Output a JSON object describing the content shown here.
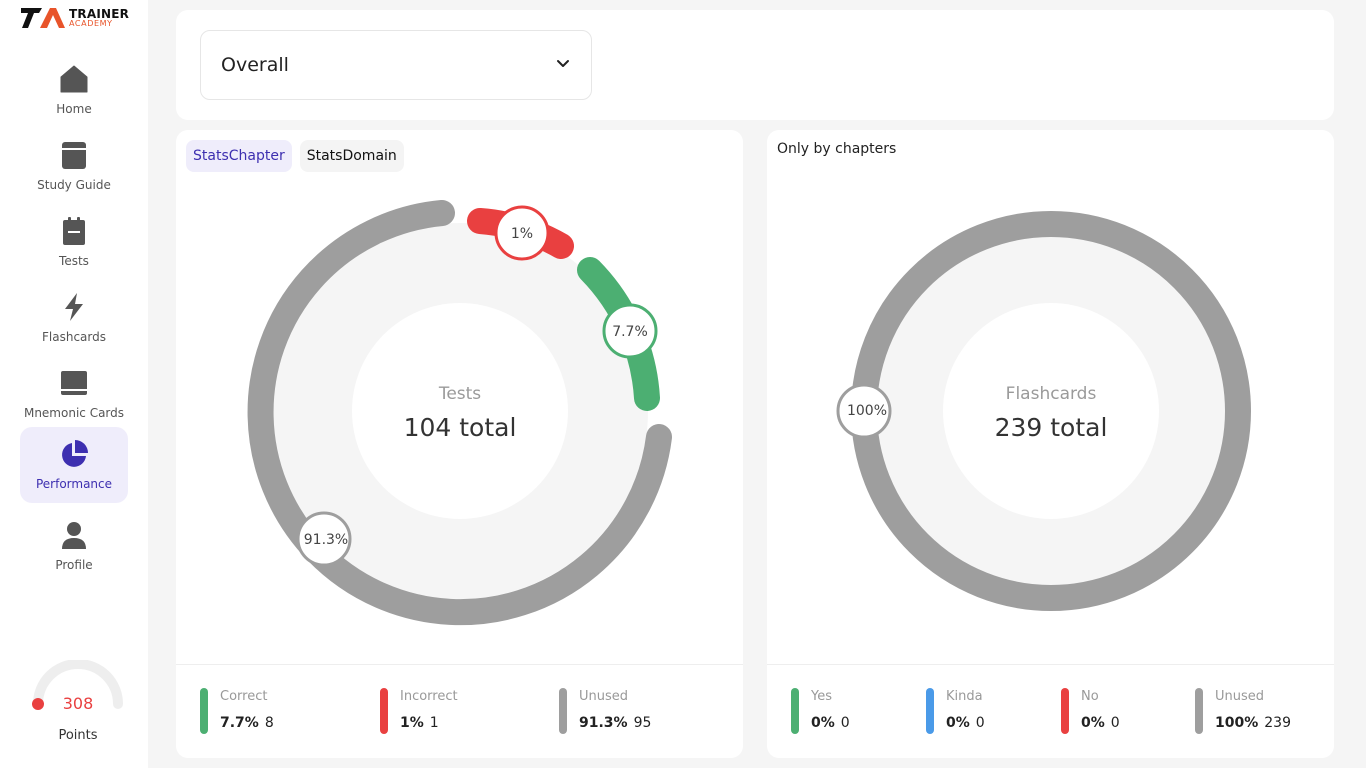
{
  "brand": {
    "line1": "TRAINER",
    "line2": "ACADEMY",
    "mark": "TA"
  },
  "sidebar": {
    "items": [
      {
        "label": "Home",
        "icon": "home-icon"
      },
      {
        "label": "Study Guide",
        "icon": "book-icon"
      },
      {
        "label": "Tests",
        "icon": "clipboard-icon"
      },
      {
        "label": "Flashcards",
        "icon": "lightning-icon"
      },
      {
        "label": "Mnemonic Cards",
        "icon": "card-icon"
      },
      {
        "label": "Performance",
        "icon": "pie-chart-icon",
        "active": true
      },
      {
        "label": "Profile",
        "icon": "user-icon"
      }
    ],
    "points": {
      "value": "308",
      "label": "Points"
    }
  },
  "filter": {
    "selected": "Overall"
  },
  "left_panel": {
    "tabs": [
      {
        "label": "StatsChapter",
        "active": true
      },
      {
        "label": "StatsDomain",
        "active": false
      }
    ],
    "center_label": "Tests",
    "center_total": "104 total",
    "pct_labels": {
      "incorrect": "1%",
      "correct": "7.7%",
      "unused": "91.3%"
    },
    "legend": [
      {
        "name": "Correct",
        "pct": "7.7%",
        "count": "8",
        "color": "#4caf72"
      },
      {
        "name": "Incorrect",
        "pct": "1%",
        "count": "1",
        "color": "#e94040"
      },
      {
        "name": "Unused",
        "pct": "91.3%",
        "count": "95",
        "color": "#9e9e9e"
      }
    ]
  },
  "right_panel": {
    "heading": "Only by chapters",
    "center_label": "Flashcards",
    "center_total": "239 total",
    "pct_labels": {
      "unused": "100%"
    },
    "legend": [
      {
        "name": "Yes",
        "pct": "0%",
        "count": "0",
        "color": "#4caf72"
      },
      {
        "name": "Kinda",
        "pct": "0%",
        "count": "0",
        "color": "#4a9ae8"
      },
      {
        "name": "No",
        "pct": "0%",
        "count": "0",
        "color": "#e94040"
      },
      {
        "name": "Unused",
        "pct": "100%",
        "count": "239",
        "color": "#9e9e9e"
      }
    ]
  },
  "colors": {
    "accent": "#3d2fb0",
    "correct": "#4caf72",
    "incorrect": "#e94040",
    "unused": "#9e9e9e",
    "kinda": "#4a9ae8"
  }
}
